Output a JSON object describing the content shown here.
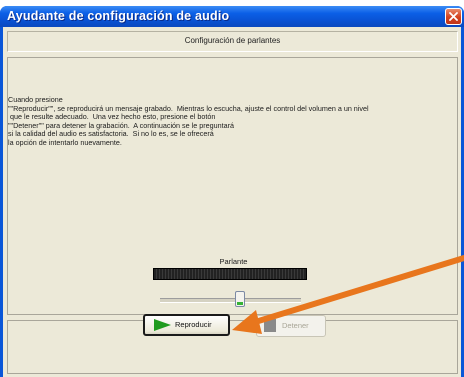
{
  "background_window": {
    "text": "·· · ·· · ···· ···· ··· ·· ··"
  },
  "dialog": {
    "title": "Ayudante de configuración de audio",
    "section_title": "Configuración de parlantes",
    "instructions": "Cuando presione\n\"\"Reproducir\"\", se reproducirá un mensaje grabado.  Mientras lo escucha, ajuste el control del volumen a un nivel\n que le resulte adecuado.  Una vez hecho esto, presione el botón\n\"\"Detener\"\" para detener la grabación.  A continuación se le preguntará\nsi la calidad del audio es satisfactoria.  Si no lo es, se le ofrecerá\nla opción de intentarlo nuevamente.",
    "meter_label": "Parlante",
    "volume_level": 0.56,
    "buttons": {
      "play": "Reproducir",
      "stop": "Detener"
    }
  },
  "colors": {
    "titlebar": "#0a56d8",
    "dialog_bg": "#ece9d8",
    "arrow": "#e8761d",
    "play_icon": "#1f9b1f"
  }
}
